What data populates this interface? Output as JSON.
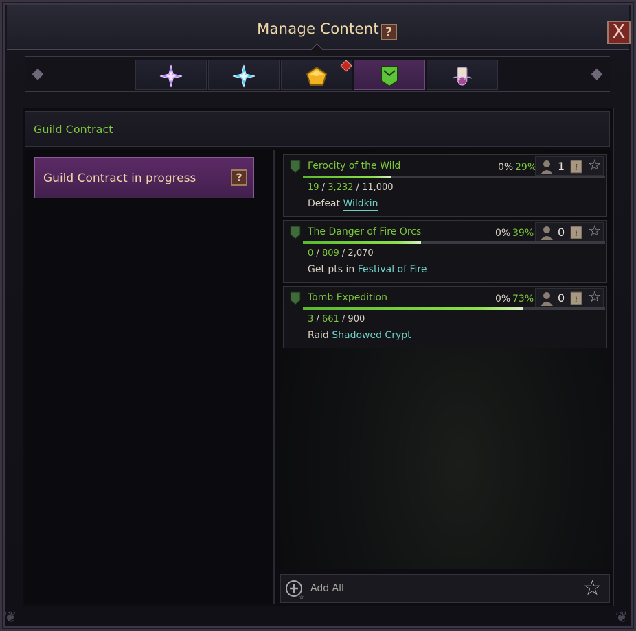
{
  "window": {
    "title": "Manage Content",
    "help_label": "?",
    "close_label": "X"
  },
  "tabs": [
    {
      "name": "purple-star-icon",
      "active": false
    },
    {
      "name": "blue-star-icon",
      "active": false
    },
    {
      "name": "gold-pentagon-icon",
      "active": false,
      "notification": true
    },
    {
      "name": "guild-shield-icon",
      "active": true
    },
    {
      "name": "scroll-seal-icon",
      "active": false
    }
  ],
  "section": {
    "title": "Guild Contract"
  },
  "left": {
    "button_label": "Guild Contract in progress",
    "help_label": "?"
  },
  "quests": [
    {
      "name": "Ferocity of the Wild",
      "pct_base": "0%",
      "pct_progress": "29%",
      "progress": 0.29,
      "participants": "1",
      "current": "19",
      "mid": "3,232",
      "total": "11,000",
      "objective_verb": "Defeat",
      "objective_target": "Wildkin"
    },
    {
      "name": "The Danger of Fire Orcs",
      "pct_base": "0%",
      "pct_progress": "39%",
      "progress": 0.39,
      "participants": "0",
      "current": "0",
      "mid": "809",
      "total": "2,070",
      "objective_verb": "Get pts in",
      "objective_target": "Festival of Fire"
    },
    {
      "name": "Tomb Expedition",
      "pct_base": "0%",
      "pct_progress": "73%",
      "progress": 0.73,
      "participants": "0",
      "current": "3",
      "mid": "661",
      "total": "900",
      "objective_verb": "Raid",
      "objective_target": "Shadowed Crypt"
    }
  ],
  "footer": {
    "add_all_label": "Add All"
  },
  "colors": {
    "accent_green": "#7cc83c",
    "link_teal": "#6fd0c8",
    "title_gold": "#efd8a6",
    "active_tab": "#4c2a58"
  }
}
